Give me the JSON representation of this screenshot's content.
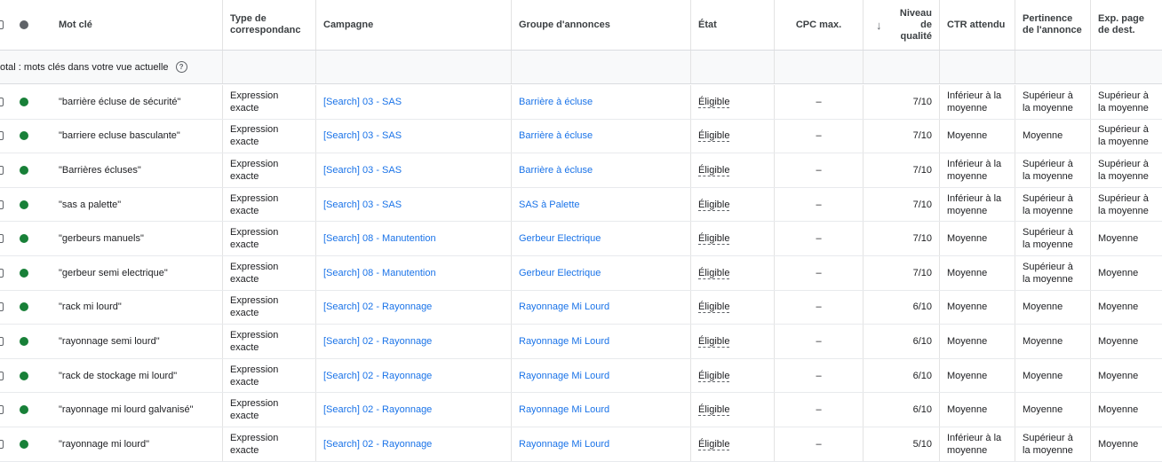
{
  "headers": {
    "keyword": "Mot clé",
    "match_type": "Type de correspondanc",
    "campaign": "Campagne",
    "ad_group": "Groupe d'annonces",
    "status": "État",
    "cpc": "CPC max.",
    "sort_icon": "arrow-down-icon",
    "quality_score": "Niveau de qualité",
    "expected_ctr": "CTR attendu",
    "ad_relevance": "Pertinence de l'annonce",
    "landing_page": "Exp. page de dest."
  },
  "total_row": {
    "label": "otal : mots clés dans votre vue actuelle",
    "help_icon": "help-icon"
  },
  "rows": [
    {
      "keyword": "\"barrière écluse de sécurité\"",
      "match": "Expression exacte",
      "campaign": "[Search] 03 - SAS",
      "ad_group": "Barrière à écluse",
      "status": "Éligible",
      "cpc": "–",
      "qs": "7/10",
      "ctr": "Inférieur à la moyenne",
      "relevance": "Supérieur à la moyenne",
      "landing": "Supérieur à la moyenne"
    },
    {
      "keyword": "\"barriere ecluse basculante\"",
      "match": "Expression exacte",
      "campaign": "[Search] 03 - SAS",
      "ad_group": "Barrière à écluse",
      "status": "Éligible",
      "cpc": "–",
      "qs": "7/10",
      "ctr": "Moyenne",
      "relevance": "Moyenne",
      "landing": "Supérieur à la moyenne"
    },
    {
      "keyword": "\"Barrières écluses\"",
      "match": "Expression exacte",
      "campaign": "[Search] 03 - SAS",
      "ad_group": "Barrière à écluse",
      "status": "Éligible",
      "cpc": "–",
      "qs": "7/10",
      "ctr": "Inférieur à la moyenne",
      "relevance": "Supérieur à la moyenne",
      "landing": "Supérieur à la moyenne"
    },
    {
      "keyword": "\"sas a palette\"",
      "match": "Expression exacte",
      "campaign": "[Search] 03 - SAS",
      "ad_group": "SAS à Palette",
      "status": "Éligible",
      "cpc": "–",
      "qs": "7/10",
      "ctr": "Inférieur à la moyenne",
      "relevance": "Supérieur à la moyenne",
      "landing": "Supérieur à la moyenne"
    },
    {
      "keyword": "\"gerbeurs manuels\"",
      "match": "Expression exacte",
      "campaign": "[Search] 08 - Manutention",
      "ad_group": "Gerbeur Electrique",
      "status": "Éligible",
      "cpc": "–",
      "qs": "7/10",
      "ctr": "Moyenne",
      "relevance": "Supérieur à la moyenne",
      "landing": "Moyenne"
    },
    {
      "keyword": "\"gerbeur semi electrique\"",
      "match": "Expression exacte",
      "campaign": "[Search] 08 - Manutention",
      "ad_group": "Gerbeur Electrique",
      "status": "Éligible",
      "cpc": "–",
      "qs": "7/10",
      "ctr": "Moyenne",
      "relevance": "Supérieur à la moyenne",
      "landing": "Moyenne"
    },
    {
      "keyword": "\"rack mi lourd\"",
      "match": "Expression exacte",
      "campaign": "[Search] 02 - Rayonnage",
      "ad_group": "Rayonnage Mi Lourd",
      "status": "Éligible",
      "cpc": "–",
      "qs": "6/10",
      "ctr": "Moyenne",
      "relevance": "Moyenne",
      "landing": "Moyenne"
    },
    {
      "keyword": "\"rayonnage semi lourd\"",
      "match": "Expression exacte",
      "campaign": "[Search] 02 - Rayonnage",
      "ad_group": "Rayonnage Mi Lourd",
      "status": "Éligible",
      "cpc": "–",
      "qs": "6/10",
      "ctr": "Moyenne",
      "relevance": "Moyenne",
      "landing": "Moyenne"
    },
    {
      "keyword": "\"rack de stockage mi lourd\"",
      "match": "Expression exacte",
      "campaign": "[Search] 02 - Rayonnage",
      "ad_group": "Rayonnage Mi Lourd",
      "status": "Éligible",
      "cpc": "–",
      "qs": "6/10",
      "ctr": "Moyenne",
      "relevance": "Moyenne",
      "landing": "Moyenne"
    },
    {
      "keyword": "\"rayonnage mi lourd galvanisé\"",
      "match": "Expression exacte",
      "campaign": "[Search] 02 - Rayonnage",
      "ad_group": "Rayonnage Mi Lourd",
      "status": "Éligible",
      "cpc": "–",
      "qs": "6/10",
      "ctr": "Moyenne",
      "relevance": "Moyenne",
      "landing": "Moyenne"
    },
    {
      "keyword": "\"rayonnage mi lourd\"",
      "match": "Expression exacte",
      "campaign": "[Search] 02 - Rayonnage",
      "ad_group": "Rayonnage Mi Lourd",
      "status": "Éligible",
      "cpc": "–",
      "qs": "5/10",
      "ctr": "Inférieur à la moyenne",
      "relevance": "Supérieur à la moyenne",
      "landing": "Moyenne"
    }
  ]
}
